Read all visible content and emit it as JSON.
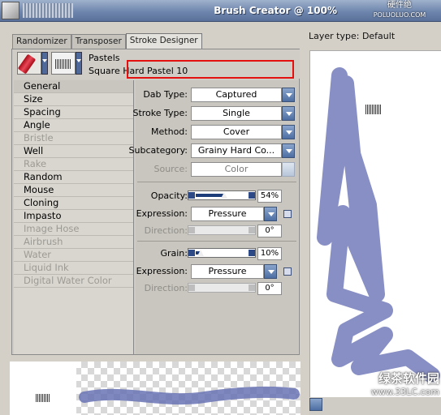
{
  "window": {
    "title": "Brush Creator @ 100%",
    "watermark_top": {
      "line1": "硬件绝",
      "line2": "POLUOLUO.COM"
    }
  },
  "tabs": [
    {
      "label": "Randomizer"
    },
    {
      "label": "Transposer"
    },
    {
      "label": "Stroke Designer"
    }
  ],
  "brush": {
    "category": "Pastels",
    "variant": "Square Hard Pastel 10"
  },
  "properties": [
    {
      "label": "General",
      "state": "selected"
    },
    {
      "label": "Size",
      "state": "enabled"
    },
    {
      "label": "Spacing",
      "state": "enabled"
    },
    {
      "label": "Angle",
      "state": "enabled"
    },
    {
      "label": "Bristle",
      "state": "disabled"
    },
    {
      "label": "Well",
      "state": "enabled"
    },
    {
      "label": "Rake",
      "state": "disabled"
    },
    {
      "label": "Random",
      "state": "enabled"
    },
    {
      "label": "Mouse",
      "state": "enabled"
    },
    {
      "label": "Cloning",
      "state": "enabled"
    },
    {
      "label": "Impasto",
      "state": "enabled"
    },
    {
      "label": "Image Hose",
      "state": "disabled"
    },
    {
      "label": "Airbrush",
      "state": "disabled"
    },
    {
      "label": "Water",
      "state": "disabled"
    },
    {
      "label": "Liquid Ink",
      "state": "disabled"
    },
    {
      "label": "Digital Water Color",
      "state": "disabled"
    }
  ],
  "settings": {
    "dab_type": {
      "label": "Dab Type:",
      "value": "Captured"
    },
    "stroke_type": {
      "label": "Stroke Type:",
      "value": "Single"
    },
    "method": {
      "label": "Method:",
      "value": "Cover"
    },
    "subcategory": {
      "label": "Subcategory:",
      "value": "Grainy Hard Co..."
    },
    "source": {
      "label": "Source:",
      "value": "Color"
    },
    "opacity": {
      "label": "Opacity:",
      "value": "54%",
      "level": 0.54
    },
    "opacity_expression": {
      "label": "Expression:",
      "value": "Pressure"
    },
    "opacity_direction": {
      "label": "Direction:",
      "value": "0°"
    },
    "grain": {
      "label": "Grain:",
      "value": "10%",
      "level": 0.1
    },
    "grain_expression": {
      "label": "Expression:",
      "value": "Pressure"
    },
    "grain_direction": {
      "label": "Direction:",
      "value": "0°"
    }
  },
  "canvas": {
    "layer_type": "Layer type: Default",
    "stroke_color": "#6a73b5",
    "watermark_bottom": {
      "line1": "绿茶软件园",
      "line2": "www.33LC.com"
    }
  },
  "colors": {
    "highlight_border": "#e40f0f",
    "accent_blue": "#4d6ea3"
  }
}
